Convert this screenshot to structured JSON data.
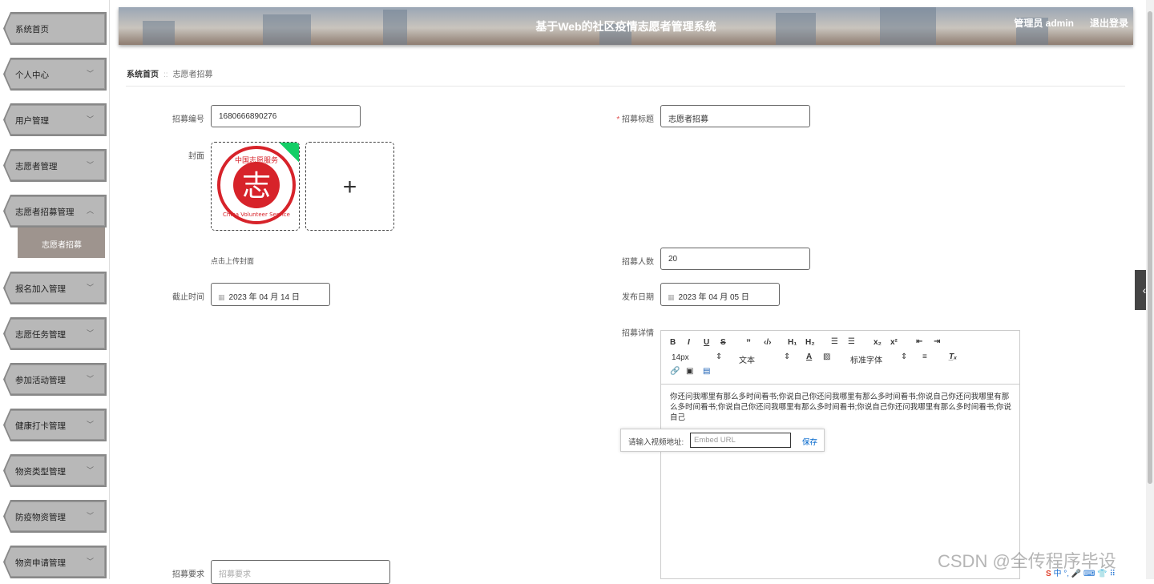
{
  "sidebar": {
    "items": [
      {
        "label": "系统首页",
        "expandable": false
      },
      {
        "label": "个人中心",
        "expandable": true
      },
      {
        "label": "用户管理",
        "expandable": true
      },
      {
        "label": "志愿者管理",
        "expandable": true
      },
      {
        "label": "志愿者招募管理",
        "expandable": true,
        "expanded": true
      },
      {
        "label": "报名加入管理",
        "expandable": true
      },
      {
        "label": "志愿任务管理",
        "expandable": true
      },
      {
        "label": "参加活动管理",
        "expandable": true
      },
      {
        "label": "健康打卡管理",
        "expandable": true
      },
      {
        "label": "物资类型管理",
        "expandable": true
      },
      {
        "label": "防疫物资管理",
        "expandable": true
      },
      {
        "label": "物资申请管理",
        "expandable": true
      }
    ],
    "submenu_label": "志愿者招募"
  },
  "header": {
    "title": "基于Web的社区疫情志愿者管理系统",
    "user": "管理员 admin",
    "logout": "退出登录"
  },
  "breadcrumb": {
    "home": "系统首页",
    "current": "志愿者招募"
  },
  "form": {
    "recruit_no": {
      "label": "招募编号",
      "value": "1680666890276"
    },
    "recruit_title": {
      "label": "招募标题",
      "value": "志愿者招募"
    },
    "cover": {
      "label": "封面",
      "hint": "点击上传封面"
    },
    "recruit_count": {
      "label": "招募人数",
      "value": "20"
    },
    "deadline": {
      "label": "截止时间",
      "value": "2023 年 04 月 14 日"
    },
    "publish_date": {
      "label": "发布日期",
      "value": "2023 年 04 月 05 日"
    },
    "detail": {
      "label": "招募详情"
    },
    "requirement": {
      "label": "招募要求",
      "placeholder": "招募要求"
    }
  },
  "editor": {
    "font_size": "14px",
    "paragraph": "文本",
    "font_family": "标准字体",
    "content": "你还问我哪里有那么多时间看书;你说自己你还问我哪里有那么多时间看书;你说自己你还问我哪里有那么多时间看书;你说自己你还问我哪里有那么多时间看书;你说自己你还问我哪里有那么多时间看书;你说自己",
    "video_tooltip": {
      "label": "请输入视频地址:",
      "placeholder": "Embed URL",
      "save": "保存"
    }
  },
  "watermark": "CSDN @全传程序毕设",
  "ime": "中 °, 🎤 ⌨ 👕 ⠿"
}
